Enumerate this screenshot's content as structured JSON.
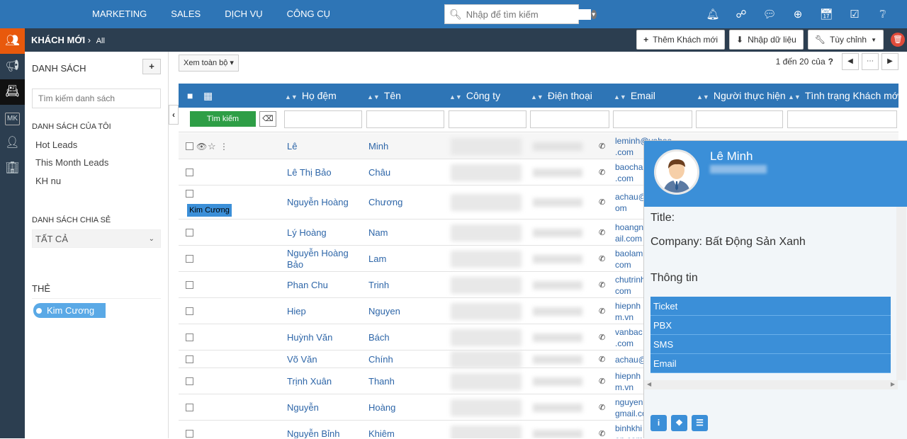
{
  "topnav": [
    "MARKETING",
    "SALES",
    "DỊCH VỤ",
    "CÔNG CỤ"
  ],
  "search": {
    "placeholder": "Nhập để tìm kiếm"
  },
  "breadcrumb": {
    "main": "KHÁCH MỚI",
    "sub": "All"
  },
  "actions": {
    "add": "Thêm Khách mới",
    "import": "Nhập dữ liệu",
    "customize": "Tùy chỉnh"
  },
  "left": {
    "title": "DANH SÁCH",
    "search_placeholder": "Tìm kiếm danh sách",
    "my_lists_title": "DANH SÁCH CỦA TÔI",
    "my_lists": [
      "Hot Leads",
      "This Month Leads",
      "KH nu"
    ],
    "shared_title": "DANH SÁCH CHIA SẺ",
    "shared_selected": "TẤT CẢ",
    "tags_title": "THẺ",
    "tag": "Kim Cương"
  },
  "view_label": "Xem toàn bộ",
  "pager": {
    "text": "1 đến 20",
    "of": "của",
    "total": "?"
  },
  "table": {
    "headers": [
      "Họ đệm",
      "Tên",
      "Công ty",
      "Điện thoại",
      "Email",
      "Người thực hiện",
      "Tình trạng Khách mới"
    ],
    "search_btn": "Tìm kiếm",
    "rows": [
      {
        "ho": "Lê",
        "ten": "Minh",
        "email": "leminh@vahoo\n.com"
      },
      {
        "ho": "Lê Thị Bảo",
        "ten": "Châu",
        "email": "baochau\n.com"
      },
      {
        "ho": "Nguyễn Hoàng",
        "ten": "Chương",
        "email": "achau@\nom",
        "tag": "Kim Cương"
      },
      {
        "ho": "Lý Hoàng",
        "ten": "Nam",
        "email": "hoangn\nail.com"
      },
      {
        "ho": "Nguyễn Hoàng\nBảo",
        "ten": "Lam",
        "email": "baolam\ncom"
      },
      {
        "ho": "Phan Chu",
        "ten": "Trinh",
        "email": "chutrinh\ncom"
      },
      {
        "ho": "Hiep",
        "ten": "Nguyen",
        "email": "hiepnh\nm.vn"
      },
      {
        "ho": "Huỳnh Văn",
        "ten": "Bách",
        "email": "vanbac\n.com"
      },
      {
        "ho": "Võ Văn",
        "ten": "Chính",
        "email": "achau@"
      },
      {
        "ho": "Trịnh Xuân",
        "ten": "Thanh",
        "email": "hiepnh\nm.vn"
      },
      {
        "ho": "Nguyễn",
        "ten": "Hoàng",
        "email": "nguyen\ngmail.co"
      },
      {
        "ho": "Nguyễn Bỉnh",
        "ten": "Khiêm",
        "email": "binhkhi\nen.com"
      }
    ]
  },
  "popup": {
    "name": "Lê Minh",
    "title_label": "Title:",
    "company_label": "Company: Bất Động Sản Xanh",
    "info_label": "Thông tin",
    "items": [
      "Ticket",
      "PBX",
      "SMS",
      "Email"
    ]
  },
  "colors": {
    "primary": "#2e75b6",
    "dark": "#2c3e50",
    "accent": "#e8590c",
    "green": "#2e9e46"
  }
}
